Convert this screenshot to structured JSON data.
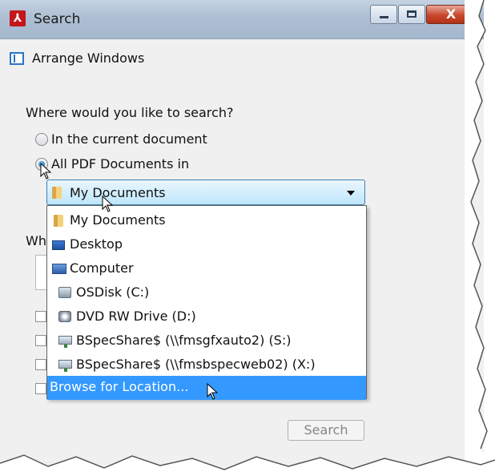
{
  "window": {
    "title": "Search",
    "icons": {
      "app": "pdf-app-icon",
      "minimize": "minimize-icon",
      "maximize": "maximize-icon",
      "close": "close-icon"
    },
    "close_label": "X"
  },
  "arrange": {
    "label": "Arrange Windows",
    "icon": "arrange-windows-icon"
  },
  "search_scope": {
    "question": "Where would you like to search?",
    "options": [
      {
        "label": "In the current document",
        "checked": false
      },
      {
        "label": "All PDF Documents in",
        "checked": true
      }
    ]
  },
  "location": {
    "selected": "My Documents",
    "items": [
      {
        "label": "My Documents",
        "icon": "folder-icon"
      },
      {
        "label": "Desktop",
        "icon": "desktop-icon"
      },
      {
        "label": "Computer",
        "icon": "computer-icon"
      },
      {
        "label": "OSDisk (C:)",
        "icon": "disk-icon"
      },
      {
        "label": "DVD RW Drive (D:)",
        "icon": "dvd-drive-icon"
      },
      {
        "label": "BSpecShare$ (\\\\fmsgfxauto2) (S:)",
        "icon": "network-drive-icon"
      },
      {
        "label": "BSpecShare$ (\\\\fmsbspecweb02) (X:)",
        "icon": "network-drive-icon"
      },
      {
        "label": "Browse for Location...",
        "icon": "",
        "highlighted": true
      }
    ]
  },
  "obscured_label": "Wh",
  "buttons": {
    "search": "Search"
  },
  "colors": {
    "accent": "#3399ff",
    "title_bar": "#aebfd3",
    "close": "#c8472c",
    "background": "#f0f0f0"
  }
}
